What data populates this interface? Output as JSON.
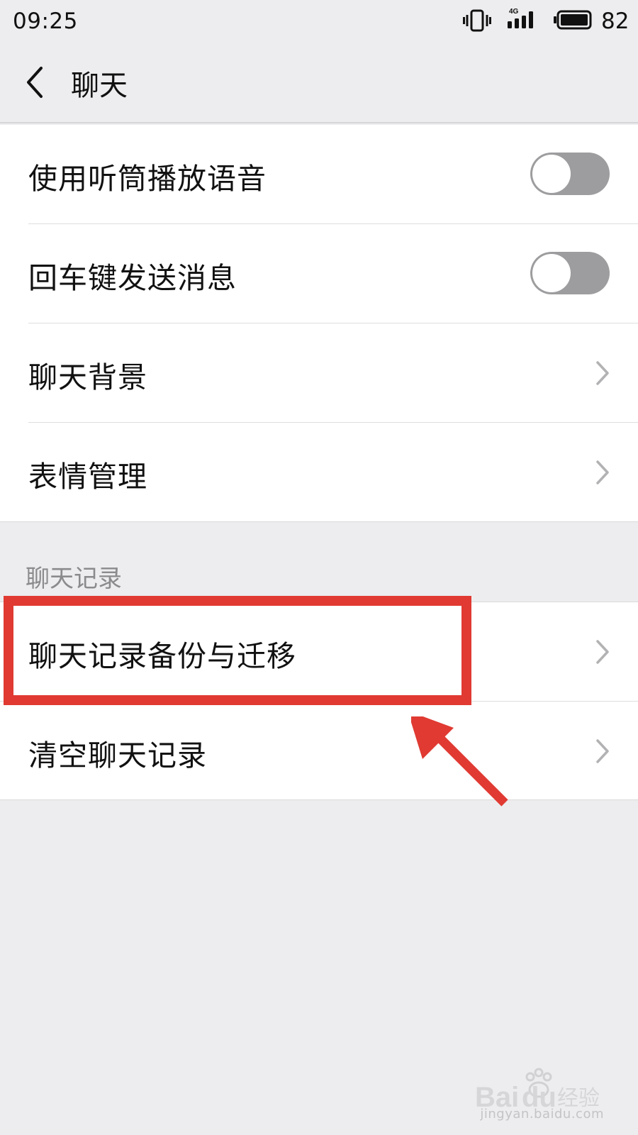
{
  "status_bar": {
    "time": "09:25",
    "network": "4G",
    "battery_level": "82",
    "icons": [
      "vibrate-icon",
      "signal-icon",
      "battery-icon"
    ]
  },
  "header": {
    "back_icon": "chevron-left-icon",
    "title": "聊天"
  },
  "settings": {
    "group_1": [
      {
        "label": "使用听筒播放语音",
        "control": "toggle",
        "state": "off"
      },
      {
        "label": "回车键发送消息",
        "control": "toggle",
        "state": "off"
      },
      {
        "label": "聊天背景",
        "control": "chevron"
      },
      {
        "label": "表情管理",
        "control": "chevron"
      }
    ],
    "section_header": "聊天记录",
    "group_2": [
      {
        "label": "聊天记录备份与迁移",
        "control": "chevron",
        "highlighted": true
      },
      {
        "label": "清空聊天记录",
        "control": "chevron"
      }
    ]
  },
  "annotation": {
    "color": "#E03A32",
    "target": "聊天记录备份与迁移"
  },
  "watermark": {
    "brand": "Baidu经验",
    "url": "jingyan.baidu.com"
  },
  "colors": {
    "background": "#EDEDEF",
    "toggle_off": "#9D9D9F",
    "section_header_text": "#8B8B8D"
  }
}
